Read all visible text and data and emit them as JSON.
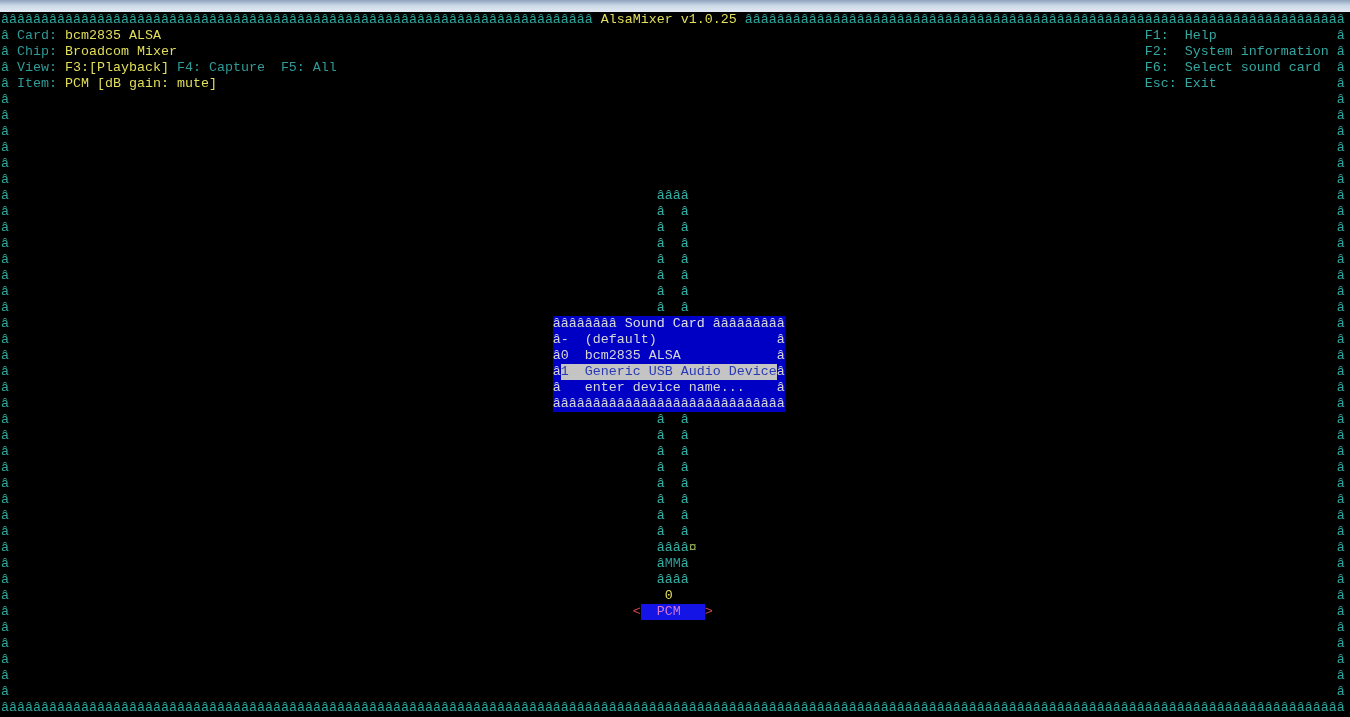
{
  "frame": {
    "top_left": "ââââââââââââââââââââââââââââââââââââââââââââââââââââââââââââââââââââââââââ",
    "title": "AlsaMixer v1.0.25",
    "top_right": "âââââââââââââââââââââââââââââââââââââââââââââââââââââââââââââââââââââââââââ",
    "left_edge": "ââââââââââââââââââââââââââââââââââââââââââ",
    "right_edge": "ââââââââââââââââââââââââââââââââââââââââââ",
    "bottom": [
      "ââââââââââ",
      "ââââââââââ",
      "ââââââââââ",
      "ââââââââââ",
      "ââââââââââ",
      "ââââââââââ",
      "ââââââââââ",
      "ââââââââââ",
      "ââââââââââ",
      "ââââââââââ",
      "ââââââââââ",
      "ââââââââââ",
      "ââââââââââ",
      "ââââââââââ",
      "ââââââââââ",
      "ââââââââââ",
      "ââââââââ"
    ]
  },
  "info": [
    {
      "kind": "value",
      "label": "Card:",
      "value": "bcm2835 ALSA"
    },
    {
      "kind": "value",
      "label": "Chip:",
      "value": "Broadcom Mixer"
    },
    {
      "kind": "views",
      "label": "View:",
      "views": [
        {
          "key": "F3:",
          "label": "[Playback]",
          "selected": true
        },
        {
          "key": "F4:",
          "label": "Capture",
          "selected": false
        },
        {
          "key": "F5:",
          "label": "All",
          "selected": false
        }
      ]
    },
    {
      "kind": "value",
      "label": "Item:",
      "value": "PCM [dB gain: mute]"
    }
  ],
  "help": [
    {
      "key": "F1:",
      "action": "Help"
    },
    {
      "key": "F2:",
      "action": "System information"
    },
    {
      "key": "F6:",
      "action": "Select sound card"
    },
    {
      "key": "Esc:",
      "action": "Exit"
    }
  ],
  "controls": [
    {
      "gauge_upper": [
        "ââââ",
        "â  â",
        "â  â",
        "â  â",
        "â  â",
        "â  â",
        "â  â",
        "â  â"
      ],
      "gauge_lower": [
        "â  â",
        "â  â",
        "â  â",
        "â  â",
        "â  â",
        "â  â",
        "â  â",
        "â  â",
        "ââââ"
      ],
      "marker": "¤",
      "mute_left": "â",
      "mute": "MM",
      "mute_right": "â",
      "gauge_bottom": "ââââ",
      "value": "0",
      "prev": "<",
      "name": "PCM",
      "next": ">",
      "selected": true
    }
  ],
  "dialog": {
    "top_left": "ââââââââ",
    "title": "Sound Card",
    "top_right": "âââââââââ",
    "left_edge": "ââââ",
    "right_edge": "ââââ",
    "items": [
      {
        "marker": "-",
        "label": "(default)",
        "selected": false
      },
      {
        "marker": "0",
        "label": "bcm2835 ALSA",
        "selected": false
      },
      {
        "marker": "1",
        "label": "Generic USB Audio Device",
        "selected": true
      },
      {
        "label": "enter device name...",
        "selected": false
      }
    ],
    "bottom": "âââââââââââââââââââââââââââââ"
  }
}
